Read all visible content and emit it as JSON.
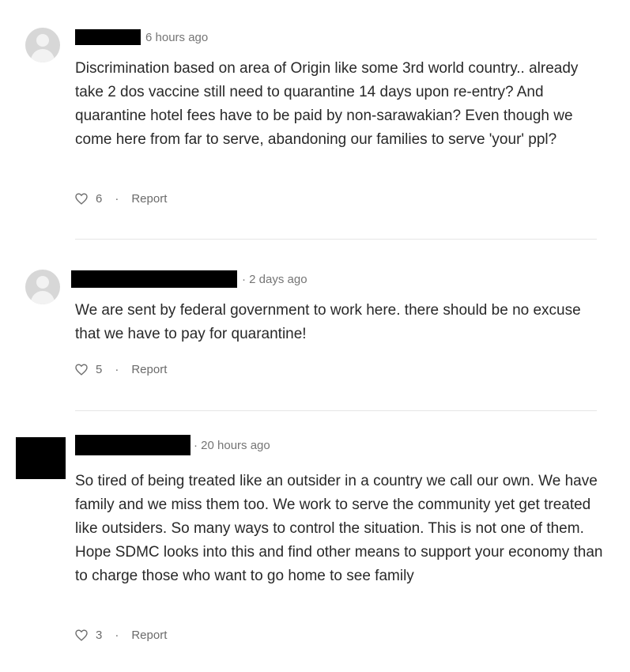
{
  "comments": [
    {
      "time": "6 hours ago",
      "text": "Discrimination based on area of Origin like some 3rd world country.. already take 2 dos vaccine still need to quarantine 14 days upon re-entry? And quarantine hotel fees have to be paid by non-sarawakian? Even though we come here from far to serve, abandoning our families to serve 'your' ppl?",
      "likes": "6",
      "report_label": "Report"
    },
    {
      "time": "· 2 days ago",
      "text": "We are sent by federal government to work here. there should be no excuse that we have to pay for quarantine!",
      "likes": "5",
      "report_label": "Report"
    },
    {
      "time": "· 20 hours ago",
      "text": "So tired of being treated like an outsider in a country we call our own. We have family and we miss them too. We work to serve the community yet get treated like outsiders. So many ways to control the situation. This is not one of them. Hope SDMC looks into this and find other means to support your economy than to charge those who want to go home to see family",
      "likes": "3",
      "report_label": "Report"
    }
  ],
  "separator": "·",
  "icons": {
    "like": "heart-icon",
    "avatar": "default-avatar-icon"
  },
  "colors": {
    "text": "#292929",
    "meta": "#757575",
    "divider": "#e6e6e6",
    "avatar_bg": "#d7d7d7",
    "redaction": "#000000"
  }
}
